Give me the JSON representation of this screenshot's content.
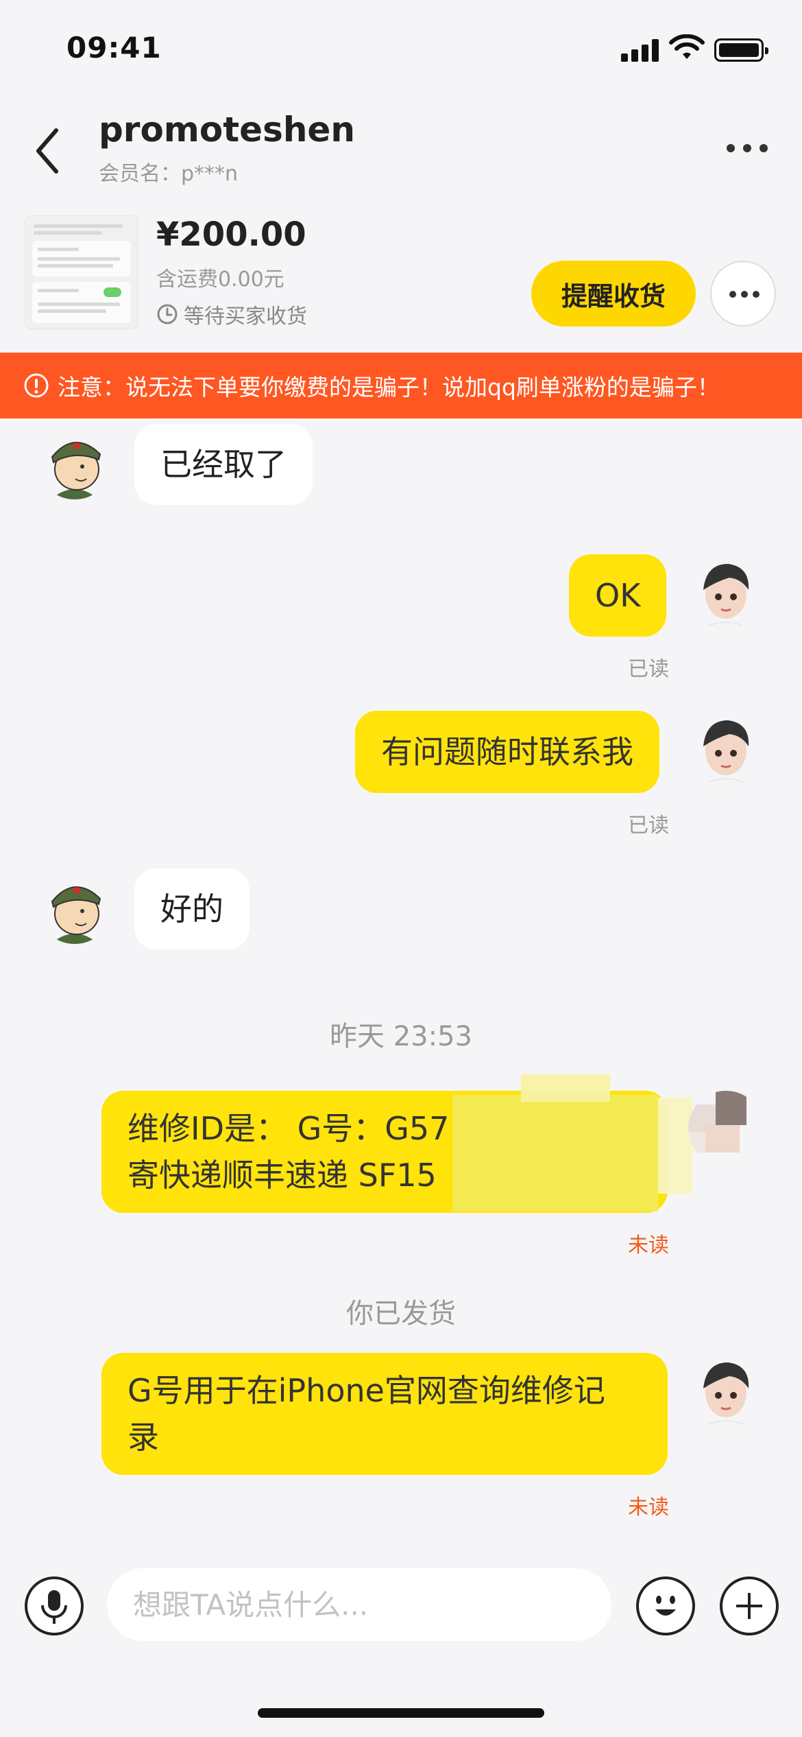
{
  "status_bar": {
    "time": "09:41"
  },
  "header": {
    "title": "promoteshen",
    "subtitle": "会员名：p***n"
  },
  "order": {
    "price": "¥200.00",
    "shipping": "含运费0.00元",
    "status": "等待买家收货",
    "remind_label": "提醒收货"
  },
  "warning": {
    "text": "注意：说无法下单要你缴费的是骗子！说加qq刷单涨粉的是骗子！"
  },
  "messages": {
    "m1": "已经取了",
    "m2": "OK",
    "m2_status": "已读",
    "m3": "有问题随时联系我",
    "m3_status": "已读",
    "m4": "好的",
    "time_divider": "昨天 23:53",
    "m5_line1": "维修ID是： G号：G57",
    "m5_line2": "寄快递顺丰速递 SF15",
    "m5_status": "未读",
    "shipped_notice": "你已发货",
    "m6_line1": "G号用于在iPhone官网查询维修记",
    "m6_line2": "录",
    "m6_status": "未读"
  },
  "input": {
    "placeholder": "想跟TA说点什么..."
  },
  "colors": {
    "accent_yellow": "#ffe30a",
    "button_yellow": "#ffd700",
    "warning_orange": "#ff5722",
    "unread_red": "#f25c19"
  },
  "icons": [
    "back-icon",
    "more-icon",
    "clock-icon",
    "alert-icon",
    "microphone-icon",
    "emoji-icon",
    "plus-icon"
  ]
}
